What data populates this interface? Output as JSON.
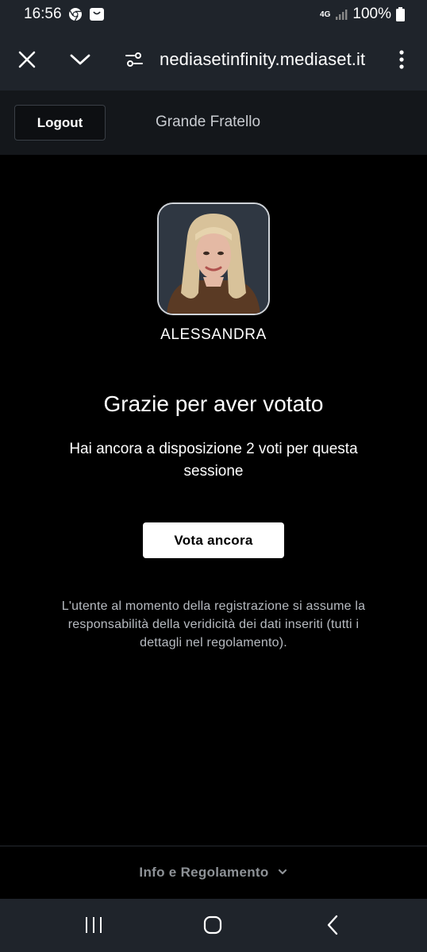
{
  "status_bar": {
    "time": "16:56",
    "network": "4G",
    "battery": "100%",
    "icons": [
      "chrome-icon",
      "shopping-bag-icon",
      "signal-icon",
      "battery-icon"
    ]
  },
  "browser": {
    "url": "nediasetinfinity.mediaset.it",
    "icons": [
      "close-icon",
      "chevron-down-icon",
      "site-settings-icon",
      "more-vert-icon"
    ]
  },
  "header": {
    "logout_label": "Logout",
    "title": "Grande Fratello"
  },
  "vote": {
    "contestant_name": "ALESSANDRA",
    "thanks_title": "Grazie per aver votato",
    "votes_remaining_text": "Hai ancora a disposizione 2 voti per questa sessione",
    "vote_again_label": "Vota ancora",
    "disclaimer": "L'utente al momento della registrazione si assume la responsabilità della veridicità dei dati inseriti (tutti i dettagli nel regolamento)."
  },
  "footer": {
    "info_label": "Info e Regolamento"
  },
  "colors": {
    "background": "#000000",
    "bar": "#1f242b",
    "header": "#14171b",
    "button_primary": "#ffffff",
    "muted_text": "#8e9297"
  }
}
